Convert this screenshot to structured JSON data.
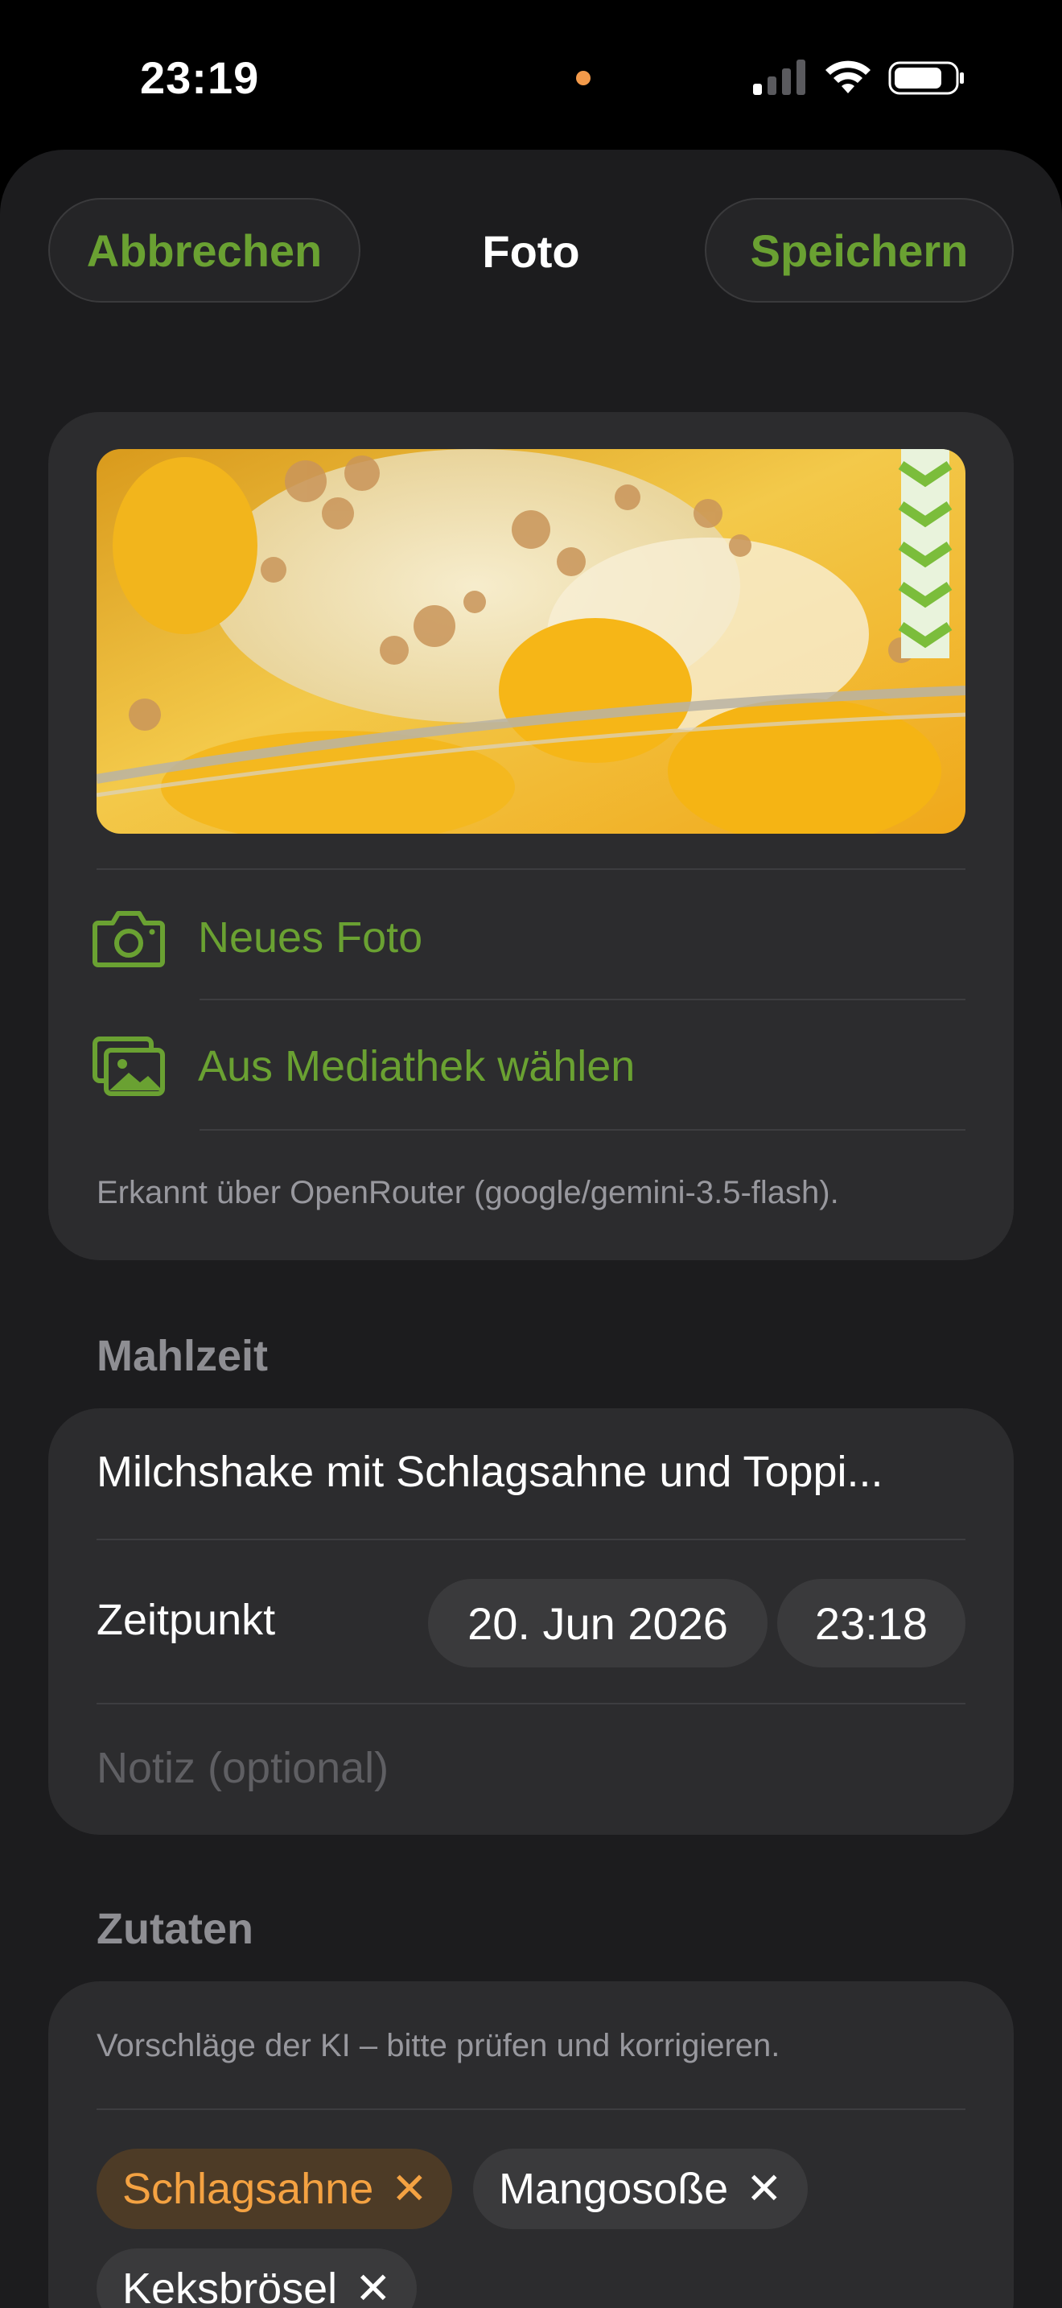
{
  "status_bar": {
    "time": "23:19",
    "recording_dot_color": "#f39a4a",
    "icons": [
      "cellular-signal-icon",
      "wifi-icon",
      "battery-icon"
    ]
  },
  "nav": {
    "cancel_label": "Abbrechen",
    "title": "Foto",
    "save_label": "Speichern",
    "accent_color": "#6aa132"
  },
  "photo_section": {
    "photo_description_icon": "food-photo",
    "actions": [
      {
        "icon": "camera-icon",
        "label": "Neues Foto"
      },
      {
        "icon": "photo-library-icon",
        "label": "Aus Mediathek wählen"
      }
    ],
    "caption": "Erkannt über OpenRouter (google/gemini-3.5-flash)."
  },
  "meal_section": {
    "header": "Mahlzeit",
    "name": "Milchshake mit Schlagsahne und Toppi...",
    "time_label": "Zeitpunkt",
    "date_value": "20. Jun 2026",
    "time_value": "23:18",
    "note_placeholder": "Notiz (optional)"
  },
  "ingredients_section": {
    "header": "Zutaten",
    "hint": "Vorschläge der KI – bitte prüfen und korrigieren.",
    "remove_symbol": "✕",
    "chips": [
      {
        "label": "Schlagsahne",
        "state": "warning",
        "color": "#f4a242"
      },
      {
        "label": "Mangosoße",
        "state": "normal"
      },
      {
        "label": "Keksbrösel",
        "state": "normal"
      }
    ]
  }
}
